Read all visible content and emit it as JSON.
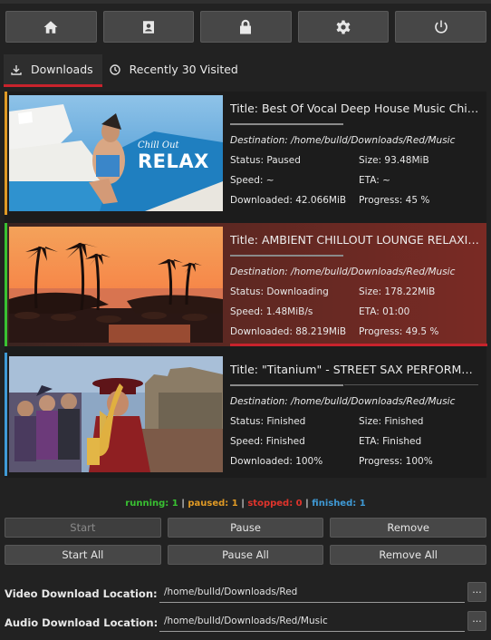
{
  "toolbar": {
    "buttons": [
      {
        "icon": "home-icon"
      },
      {
        "icon": "contact-card-icon"
      },
      {
        "icon": "lock-icon"
      },
      {
        "icon": "gear-icon"
      },
      {
        "icon": "power-icon"
      }
    ]
  },
  "tabs": [
    {
      "label": "Downloads",
      "icon": "download-icon",
      "active": true
    },
    {
      "label": "Recently 30 Visited",
      "icon": "clock-icon",
      "active": false
    }
  ],
  "downloads": [
    {
      "title": "Title: Best Of Vocal Deep House Music Chill Out Mix",
      "destination": "Destination: /home/bulld/Downloads/Red/Music",
      "status": "Status: Paused",
      "size": "Size: 93.48MiB",
      "speed": "Speed: ~",
      "eta": "ETA: ~",
      "downloaded": "Downloaded: 42.066MiB",
      "progress": "Progress: 45 %",
      "thumb_overlay_1": "Chill Out",
      "thumb_overlay_2": "RELAX",
      "status_color": "#e09a25"
    },
    {
      "title": "Title: AMBIENT CHILLOUT LOUNGE RELAXING MUSIC",
      "destination": "Destination: /home/bulld/Downloads/Red/Music",
      "status": "Status: Downloading",
      "size": "Size: 178.22MiB",
      "speed": "Speed:  1.48MiB/s",
      "eta": "ETA: 01:00",
      "downloaded": "Downloaded: 88.219MiB",
      "progress": "Progress: 49.5 %",
      "status_color": "#39c232"
    },
    {
      "title": "Title: \"Titanium\" - STREET SAX PERFORMANCE",
      "destination": "Destination: /home/bulld/Downloads/Red/Music",
      "status": "Status: Finished",
      "size": "Size: Finished",
      "speed": "Speed: Finished",
      "eta": "ETA: Finished",
      "downloaded": "Downloaded: 100%",
      "progress": "Progress: 100%",
      "status_color": "#3f9ad6"
    }
  ],
  "summary": {
    "running": "running: 1",
    "paused": "paused: 1",
    "stopped": "stopped: 0",
    "finished": "finished: 1",
    "sep": "|"
  },
  "buttons": {
    "start": "Start",
    "pause": "Pause",
    "remove": "Remove",
    "start_all": "Start All",
    "pause_all": "Pause All",
    "remove_all": "Remove All"
  },
  "locations": {
    "video_label": "Video Download Location:",
    "video_path": "/home/bulld/Downloads/Red",
    "audio_label": "Audio Download Location:",
    "audio_path": "/home/bulld/Downloads/Red/Music",
    "browse": "..."
  },
  "colors": {
    "accent": "#c8232c",
    "downloading_bg": "#6e2621",
    "paused": "#e09a25",
    "running": "#39c232",
    "finished": "#3f9ad6"
  }
}
